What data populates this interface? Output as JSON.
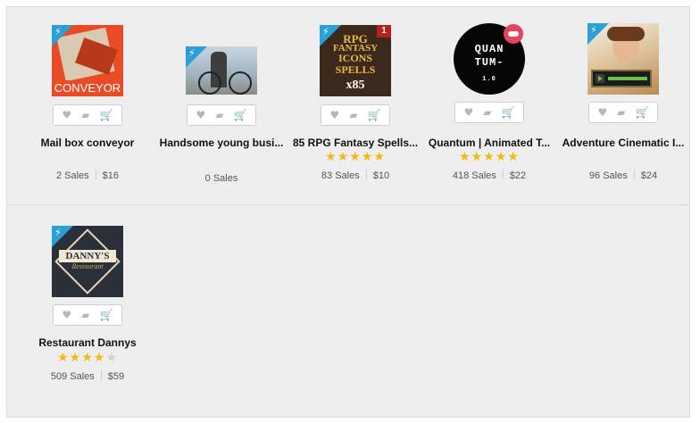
{
  "items": [
    {
      "title": "Mail box conveyor",
      "sales": "2 Sales",
      "price": "$16",
      "thumb_text": "CONVEYOR",
      "rating": null
    },
    {
      "title": "Handsome young busi...",
      "sales": "0 Sales",
      "price": "",
      "thumb_text": "",
      "rating": null
    },
    {
      "title": "85 RPG Fantasy Spells...",
      "sales": "83 Sales",
      "price": "$10",
      "thumb_text_lines": [
        "RPG",
        "FANTASY",
        "ICONS",
        "SPELLS",
        "x85"
      ],
      "badge": "1",
      "rating": 5
    },
    {
      "title": "Quantum | Animated T...",
      "sales": "418 Sales",
      "price": "$22",
      "thumb_text_lines": [
        "QUAN",
        "TUM-",
        "1.0"
      ],
      "rating": 5
    },
    {
      "title": "Adventure Cinematic I...",
      "sales": "96 Sales",
      "price": "$24",
      "rating": null
    },
    {
      "title": "Restaurant Dannys",
      "sales": "509 Sales",
      "price": "$59",
      "thumb_text_lines": [
        "DANNY'S",
        "Restaurant"
      ],
      "rating": 4.5
    }
  ],
  "icons": {
    "favorite": "heart-icon",
    "collection": "folder-icon",
    "cart": "cart-icon",
    "featured": "lightning-icon"
  },
  "colors": {
    "panel_bg": "#eeeeee",
    "flash_badge": "#2a9fd8",
    "star": "#f2b90f"
  }
}
